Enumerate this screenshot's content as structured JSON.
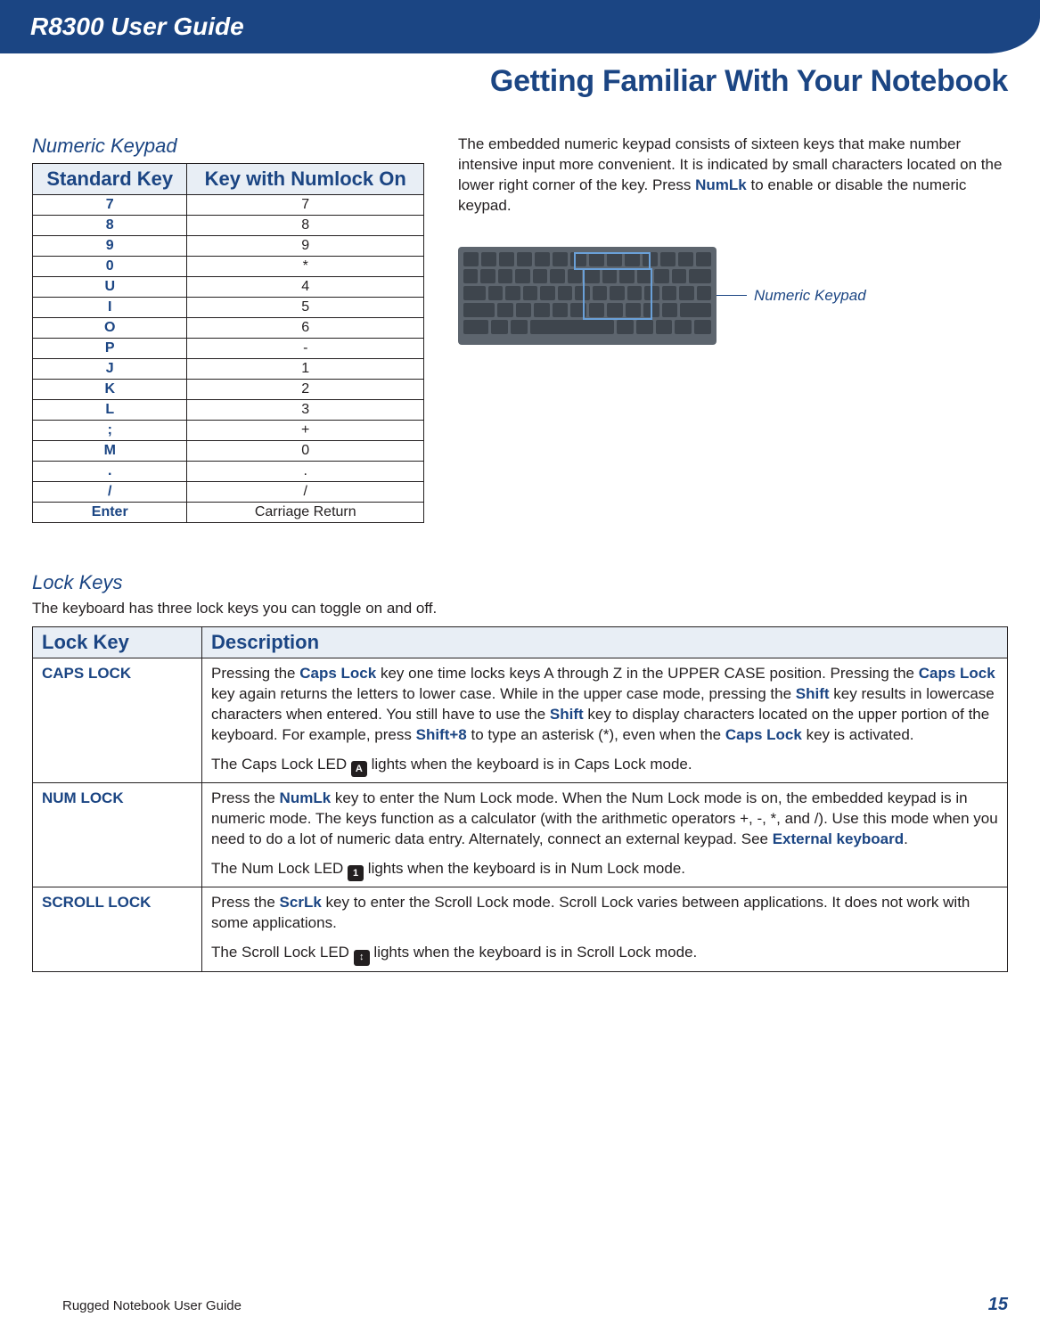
{
  "header": {
    "title": "R8300 User Guide"
  },
  "chapter": {
    "title": "Getting Familiar With Your Notebook"
  },
  "numeric_keypad": {
    "section_title": "Numeric Keypad",
    "headers": {
      "std": "Standard Key",
      "num": "Key with Numlock On"
    },
    "rows": [
      {
        "std": "7",
        "num": "7"
      },
      {
        "std": "8",
        "num": "8"
      },
      {
        "std": "9",
        "num": "9"
      },
      {
        "std": "0",
        "num": "*"
      },
      {
        "std": "U",
        "num": "4"
      },
      {
        "std": "I",
        "num": "5"
      },
      {
        "std": "O",
        "num": "6"
      },
      {
        "std": "P",
        "num": "-"
      },
      {
        "std": "J",
        "num": "1"
      },
      {
        "std": "K",
        "num": "2"
      },
      {
        "std": "L",
        "num": "3"
      },
      {
        "std": ";",
        "num": "+"
      },
      {
        "std": "M",
        "num": "0"
      },
      {
        "std": ".",
        "num": "."
      },
      {
        "std": "/",
        "num": "/"
      },
      {
        "std": "Enter",
        "num": "Carriage Return"
      }
    ]
  },
  "paragraph": {
    "pre": "The embedded numeric keypad consists of sixteen keys that make number intensive input more convenient. It is indicated by small characters located on the lower right corner of the key. Press ",
    "kw": "NumLk",
    "post": " to enable or disable the numeric keypad."
  },
  "figure": {
    "callout": "Numeric Keypad"
  },
  "lock_keys": {
    "section_title": "Lock Keys",
    "intro": "The keyboard has three lock keys you can toggle on and off.",
    "headers": {
      "name": "Lock Key",
      "desc": "Description"
    },
    "rows": [
      {
        "name": "CAPS LOCK",
        "segments": [
          {
            "t": "Pressing the "
          },
          {
            "kw": "Caps Lock"
          },
          {
            "t": " key one time locks keys A through Z in the UPPER CASE position. Pressing the "
          },
          {
            "kw": "Caps Lock"
          },
          {
            "t": " key again returns the letters to lower case. While in the upper case mode, pressing the "
          },
          {
            "kw": "Shift"
          },
          {
            "t": " key results in lowercase characters when entered. You still have to use the "
          },
          {
            "kw": "Shift"
          },
          {
            "t": " key to display characters located on the upper portion of the keyboard. For example, press "
          },
          {
            "kw": "Shift+8"
          },
          {
            "t": " to type an asterisk (*), even when the "
          },
          {
            "kw": "Caps Lock"
          },
          {
            "t": " key is activated."
          }
        ],
        "led_line_pre": "The Caps Lock LED ",
        "led_glyph": "A",
        "led_line_post": " lights when the keyboard is in Caps Lock mode."
      },
      {
        "name": "NUM LOCK",
        "segments": [
          {
            "t": "Press the "
          },
          {
            "kw": "NumLk"
          },
          {
            "t": " key to enter the Num Lock mode. When the Num Lock mode is on, the embedded keypad is in numeric mode. The keys function as a calculator (with the arithmetic operators +, -, *, and /). Use this mode when you need to do a lot of numeric data entry. Alternately, connect an external keypad. See "
          },
          {
            "kw": "External keyboard"
          },
          {
            "t": "."
          }
        ],
        "led_line_pre": "The Num Lock LED ",
        "led_glyph": "1",
        "led_line_post": " lights when the keyboard is in Num Lock mode."
      },
      {
        "name": "SCROLL LOCK",
        "segments": [
          {
            "t": "Press the "
          },
          {
            "kw": "ScrLk"
          },
          {
            "t": " key to enter the Scroll Lock mode. Scroll Lock varies between applications. It does not work with some applications."
          }
        ],
        "led_line_pre": "The Scroll Lock LED ",
        "led_glyph": "↕",
        "led_line_post": " lights when the keyboard is in Scroll Lock mode."
      }
    ]
  },
  "footer": {
    "left": "Rugged Notebook User Guide",
    "page": "15"
  }
}
